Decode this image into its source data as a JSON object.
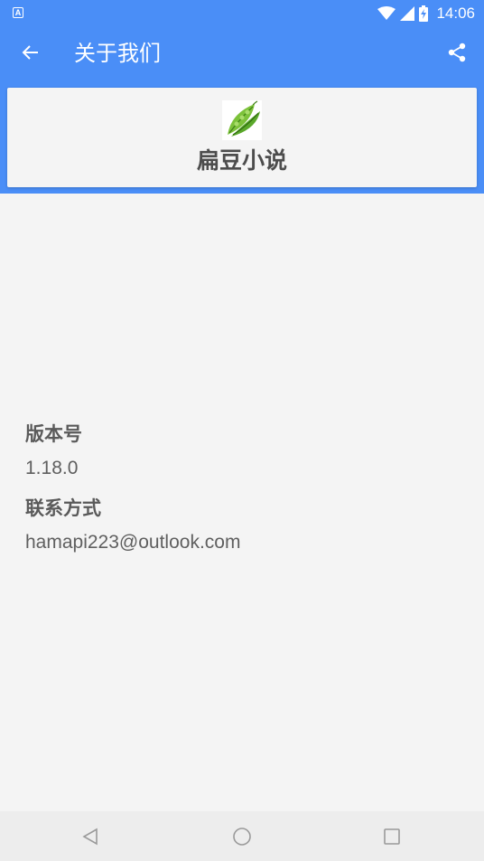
{
  "status_bar": {
    "app_icon_letter": "A",
    "time": "14:06",
    "icons": [
      "wifi-icon",
      "signal-icon",
      "battery-charging-icon"
    ]
  },
  "app_bar": {
    "title": "关于我们",
    "back_icon": "arrow-left-icon",
    "share_icon": "share-icon"
  },
  "brand": {
    "logo_icon": "pea-pod-icon",
    "name": "扁豆小说"
  },
  "info": {
    "version_label": "版本号",
    "version_value": "1.18.0",
    "contact_label": "联系方式",
    "contact_value": "hamapi223@outlook.com"
  },
  "nav_bar": {
    "icons": [
      "nav-back-icon",
      "nav-home-icon",
      "nav-recents-icon"
    ]
  },
  "colors": {
    "primary": "#4a8ef7",
    "background": "#f4f4f4",
    "text": "#5f5f5f"
  }
}
